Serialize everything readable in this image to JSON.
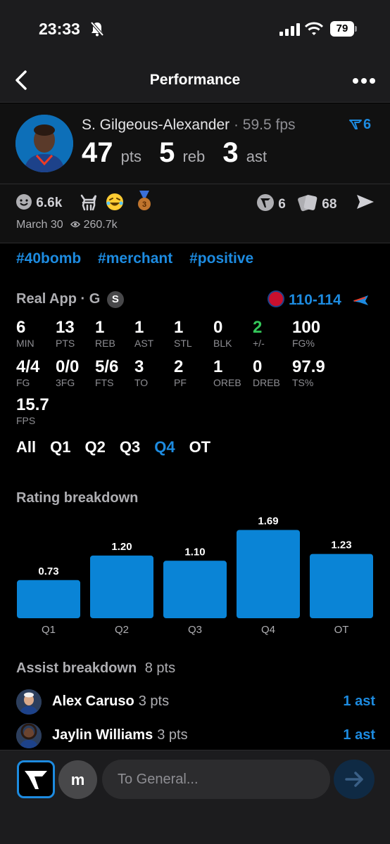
{
  "status": {
    "time": "23:33",
    "battery": "79"
  },
  "nav": {
    "title": "Performance"
  },
  "player": {
    "name": "S. Gilgeous-Alexander",
    "fps_label": "· 59.5 fps",
    "vs_count": "6",
    "pts": "47",
    "pts_unit": "pts",
    "reb": "5",
    "reb_unit": "reb",
    "ast": "3",
    "ast_unit": "ast"
  },
  "reactions": {
    "likes": "6.6k",
    "shares": "6",
    "cards": "68",
    "date": "March 30",
    "views": "260.7k"
  },
  "tags": [
    "#40bomb",
    "#merchant",
    "#positive"
  ],
  "game": {
    "source": "Real App · G",
    "badge": "S",
    "score": "110-114"
  },
  "stats": [
    {
      "v": "6",
      "l": "MIN"
    },
    {
      "v": "13",
      "l": "PTS"
    },
    {
      "v": "1",
      "l": "REB"
    },
    {
      "v": "1",
      "l": "AST"
    },
    {
      "v": "1",
      "l": "STL"
    },
    {
      "v": "0",
      "l": "BLK"
    },
    {
      "v": "2",
      "l": "+/-"
    },
    {
      "v": "100",
      "l": "FG%"
    },
    {
      "v": "4/4",
      "l": "FG"
    },
    {
      "v": "0/0",
      "l": "3FG"
    },
    {
      "v": "5/6",
      "l": "FTS"
    },
    {
      "v": "3",
      "l": "TO"
    },
    {
      "v": "2",
      "l": "PF"
    },
    {
      "v": "1",
      "l": "OREB"
    },
    {
      "v": "0",
      "l": "DREB"
    },
    {
      "v": "97.9",
      "l": "TS%"
    },
    {
      "v": "15.7",
      "l": "FPS"
    }
  ],
  "quarter_tabs": [
    "All",
    "Q1",
    "Q2",
    "Q3",
    "Q4",
    "OT"
  ],
  "active_tab": "Q4",
  "rating": {
    "title": "Rating breakdown"
  },
  "chart_data": {
    "type": "bar",
    "title": "Rating breakdown",
    "categories": [
      "Q1",
      "Q2",
      "Q3",
      "Q4",
      "OT"
    ],
    "values": [
      0.73,
      1.2,
      1.1,
      1.69,
      1.23
    ],
    "value_labels": [
      "0.73",
      "1.20",
      "1.10",
      "1.69",
      "1.23"
    ],
    "color": "#0a84d6",
    "ylim": [
      0,
      1.75
    ]
  },
  "assists": {
    "title": "Assist breakdown",
    "total": "8 pts",
    "rows": [
      {
        "name": "Alex Caruso",
        "pts": "3 pts",
        "count": "1 ast"
      },
      {
        "name": "Jaylin Williams",
        "pts": "3 pts",
        "count": "1 ast"
      }
    ]
  },
  "chat": {
    "avatar_letter": "m",
    "placeholder": "To General..."
  },
  "colors": {
    "accent": "#1d8be0",
    "positive": "#34c759",
    "background": "#000000"
  }
}
